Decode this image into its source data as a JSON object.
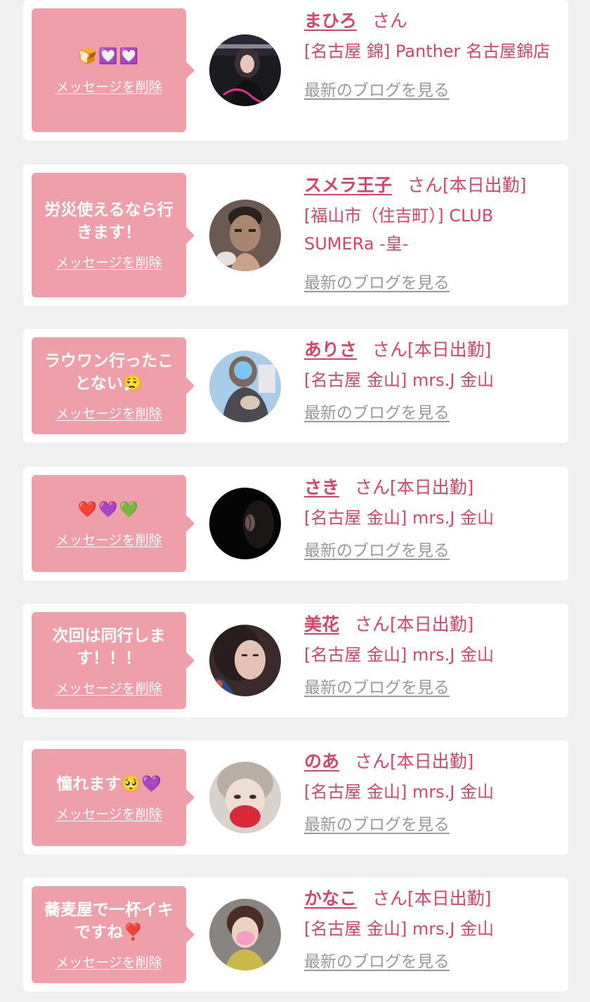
{
  "delete_label": "メッセージを削除",
  "blog_label": "最新のブログを見る",
  "honorific": "さん",
  "colors": {
    "background": "#f0f0f0",
    "card": "#ffffff",
    "bubble": "#ef9fa9",
    "accent": "#d84466",
    "muted_link": "#999999"
  },
  "entries": [
    {
      "message": "🍞💟💟",
      "message_is_emoji": true,
      "name": "まひろ",
      "status": "",
      "shop": "[名古屋 錦] Panther 名古屋錦店",
      "avatar_icon": "avatar-photo"
    },
    {
      "message": "労災使えるなら行きます！",
      "message_is_emoji": false,
      "name": "スメラ王子",
      "status": "[本日出勤]",
      "shop": "[福山市（住吉町）] CLUB SUMERa -皇-",
      "avatar_icon": "avatar-photo"
    },
    {
      "message": "ラウワン行ったことない😮‍💨",
      "message_is_emoji": false,
      "name": "ありさ",
      "status": "[本日出勤]",
      "shop": "[名古屋 金山] mrs.J 金山",
      "avatar_icon": "avatar-photo"
    },
    {
      "message": "❤️💜💚",
      "message_is_emoji": true,
      "name": "さき",
      "status": "[本日出勤]",
      "shop": "[名古屋 金山] mrs.J 金山",
      "avatar_icon": "avatar-photo"
    },
    {
      "message": "次回は同行します！！！",
      "message_is_emoji": false,
      "name": "美花",
      "status": "[本日出勤]",
      "shop": "[名古屋 金山] mrs.J 金山",
      "avatar_icon": "avatar-photo"
    },
    {
      "message": "憧れます🥺💜",
      "message_is_emoji": false,
      "name": "のあ",
      "status": "[本日出勤]",
      "shop": "[名古屋 金山] mrs.J 金山",
      "avatar_icon": "avatar-photo"
    },
    {
      "message": "蕎麦屋で一杯イキですね❣️",
      "message_is_emoji": false,
      "name": "かなこ",
      "status": "[本日出勤]",
      "shop": "[名古屋 金山] mrs.J 金山",
      "avatar_icon": "avatar-photo"
    }
  ]
}
